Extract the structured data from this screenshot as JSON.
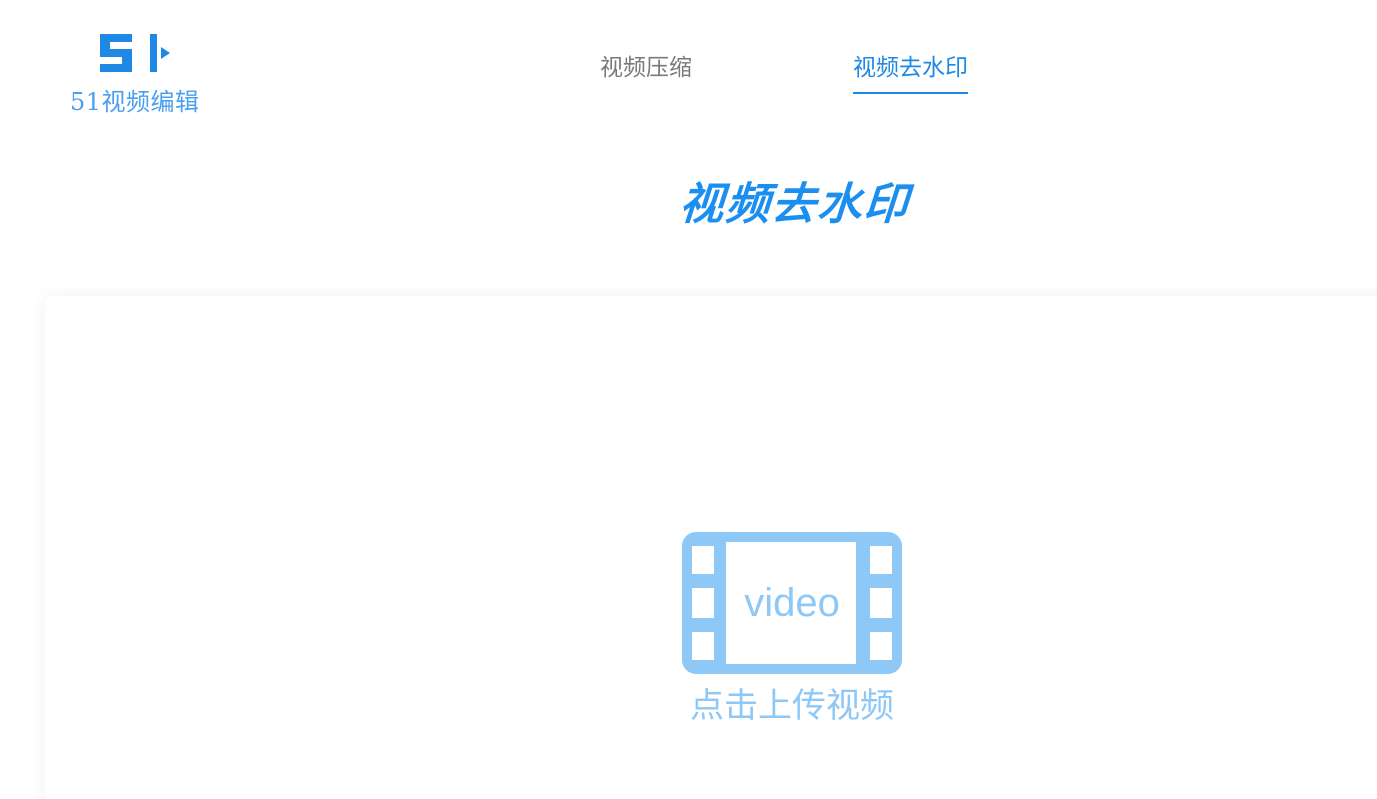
{
  "logo": {
    "mark_text": "51",
    "name": "51视频编辑"
  },
  "nav": {
    "items": [
      {
        "label": "视频压缩",
        "active": false
      },
      {
        "label": "视频去水印",
        "active": true
      }
    ]
  },
  "main": {
    "title": "视频去水印"
  },
  "upload": {
    "icon_text": "video",
    "label": "点击上传视频"
  },
  "colors": {
    "accent": "#1e88e5",
    "logo": "#4a9ff0",
    "upload_icon": "#8ec8f6",
    "nav_inactive": "#7a7a7a"
  },
  "icons": {
    "upload": "video-film-icon",
    "logo": "logo-51-icon"
  }
}
